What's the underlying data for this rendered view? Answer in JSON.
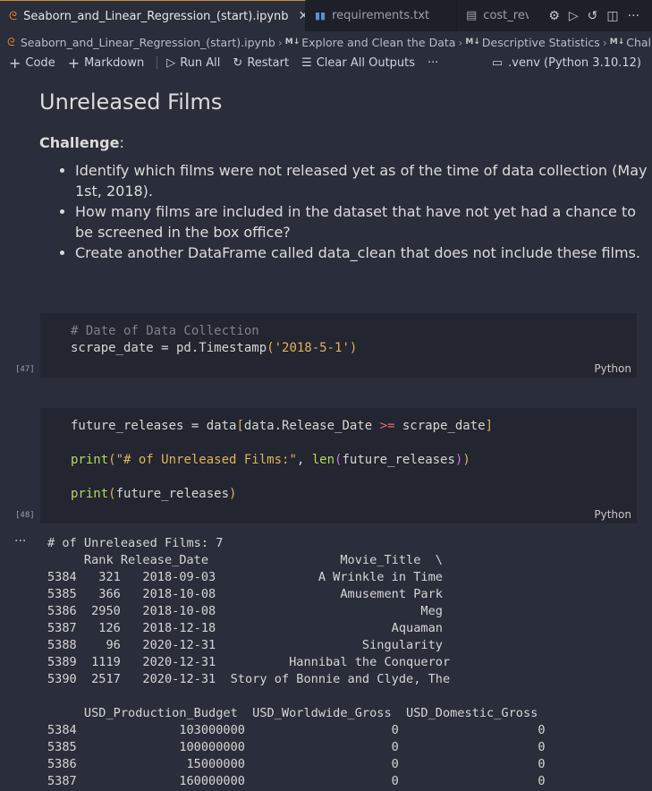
{
  "tabs": [
    {
      "label": "Seaborn_and_Linear_Regression_(start).ipynb",
      "active": true
    },
    {
      "label": "requirements.txt",
      "active": false
    },
    {
      "label": "cost_reve",
      "active": false
    }
  ],
  "breadcrumb": {
    "file": "Seaborn_and_Linear_Regression_(start).ipynb",
    "items": [
      "Explore and Clean the Data",
      "Descriptive Statistics",
      "Challe"
    ]
  },
  "toolbar": {
    "code": "Code",
    "markdown": "Markdown",
    "run_all": "Run All",
    "restart": "Restart",
    "clear_outputs": "Clear All Outputs",
    "more": "···",
    "kernel": ".venv (Python 3.10.12)"
  },
  "markdown_cell": {
    "heading": "Unreleased Films",
    "challenge_label": "Challenge",
    "challenge_colon": ":",
    "bullets": [
      "Identify which films were not released yet as of the time of data collection (May 1st, 2018).",
      "How many films are included in the dataset that have not yet had a chance to be screened in the box office?",
      "Create another DataFrame called data_clean that does not include these films."
    ]
  },
  "cell47": {
    "exec": "[47]",
    "lang": "Python",
    "comment": "# Date of Data Collection",
    "line2_a": "scrape_date = pd.Timestamp",
    "line2_b": "(",
    "line2_c": "'2018-5-1'",
    "line2_d": ")"
  },
  "cell48": {
    "exec": "[48]",
    "lang": "Python",
    "l1_a": "future_releases = data",
    "l1_b": "[",
    "l1_c": "data.Release_Date ",
    "l1_d": ">=",
    "l1_e": " scrape_date",
    "l1_f": "]",
    "l2_a": "print",
    "l2_b": "(",
    "l2_c": "\"# of Unreleased Films:\"",
    "l2_d": ", ",
    "l2_e": "len",
    "l2_f": "(",
    "l2_g": "future_releases",
    "l2_h": ")",
    "l2_i": ")",
    "l3_a": "print",
    "l3_b": "(",
    "l3_c": "future_releases",
    "l3_d": ")"
  },
  "output": {
    "more": "···",
    "lines": [
      "# of Unreleased Films: 7",
      "     Rank Release_Date                  Movie_Title  \\",
      "5384   321   2018-09-03              A Wrinkle in Time   ",
      "5385   366   2018-10-08                 Amusement Park   ",
      "5386  2950   2018-10-08                            Meg   ",
      "5387   126   2018-12-18                        Aquaman   ",
      "5388    96   2020-12-31                    Singularity   ",
      "5389  1119   2020-12-31          Hannibal the Conqueror   ",
      "5390  2517   2020-12-31  Story of Bonnie and Clyde, The   ",
      "",
      "     USD_Production_Budget  USD_Worldwide_Gross  USD_Domestic_Gross  ",
      "5384              103000000                    0                   0  ",
      "5385              100000000                    0                   0  ",
      "5386               15000000                    0                   0  ",
      "5387              160000000                    0                   0  "
    ]
  }
}
